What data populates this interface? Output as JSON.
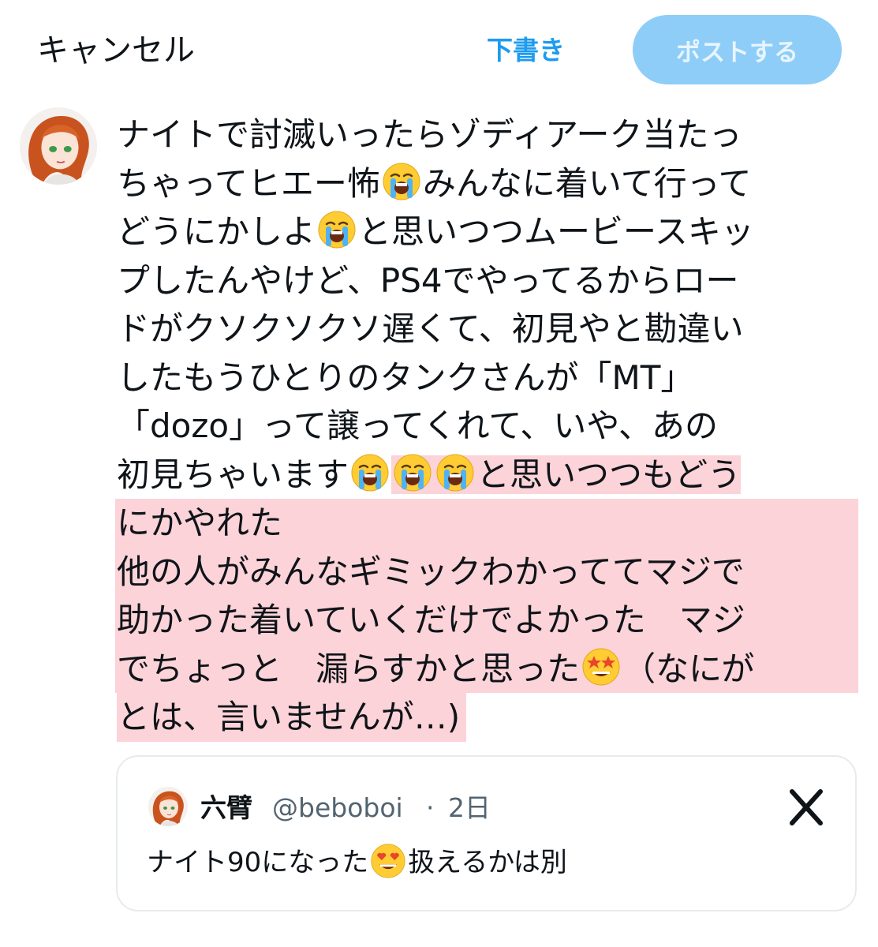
{
  "header": {
    "cancel_label": "キャンセル",
    "draft_label": "下書き",
    "post_label": "ポストする"
  },
  "compose": {
    "lines": [
      {
        "text": "ナイトで討滅いったらゾディアーク当たっ"
      },
      {
        "pre": "ちゃってヒエー怖",
        "emoji": "loudly-crying-face",
        "post": "みんなに着いて行って"
      },
      {
        "pre": "どうにかしよ",
        "emoji": "loudly-crying-face",
        "post": "と思いつつムービースキッ"
      },
      {
        "text": "プしたんやけど、PS4でやってるからロー"
      },
      {
        "text": "ドがクソクソクソ遅くて、初見やと勘違い"
      },
      {
        "text": "したもうひとりのタンクさんが「MT」"
      },
      {
        "text": "「dozo」って譲ってくれて、いや、あの"
      },
      {
        "pre": "初見ちゃいます",
        "post": "と思いつつもどう"
      },
      {
        "text": "にかやれた"
      },
      {
        "text": "他の人がみんなギミックわかっててマジで"
      },
      {
        "text": "助かった着いていくだけでよかった　マジ"
      },
      {
        "pre": "でちょっと　漏らすかと思った",
        "emoji": "star-struck",
        "post": "（なにが"
      },
      {
        "text": "とは、言いませんが…)"
      }
    ]
  },
  "quote": {
    "name": "六臂",
    "handle": "@beboboi",
    "separator": "·",
    "time": "2日",
    "text_pre": "ナイト90になった",
    "emoji": "smiling-face-with-heart-eyes",
    "text_post": "扱えるかは別"
  },
  "colors": {
    "accent": "#1d9bf0",
    "post_button_bg": "#8ecdf8",
    "highlight": "#fcd3d8",
    "text": "#0f1419",
    "muted": "#536471"
  }
}
